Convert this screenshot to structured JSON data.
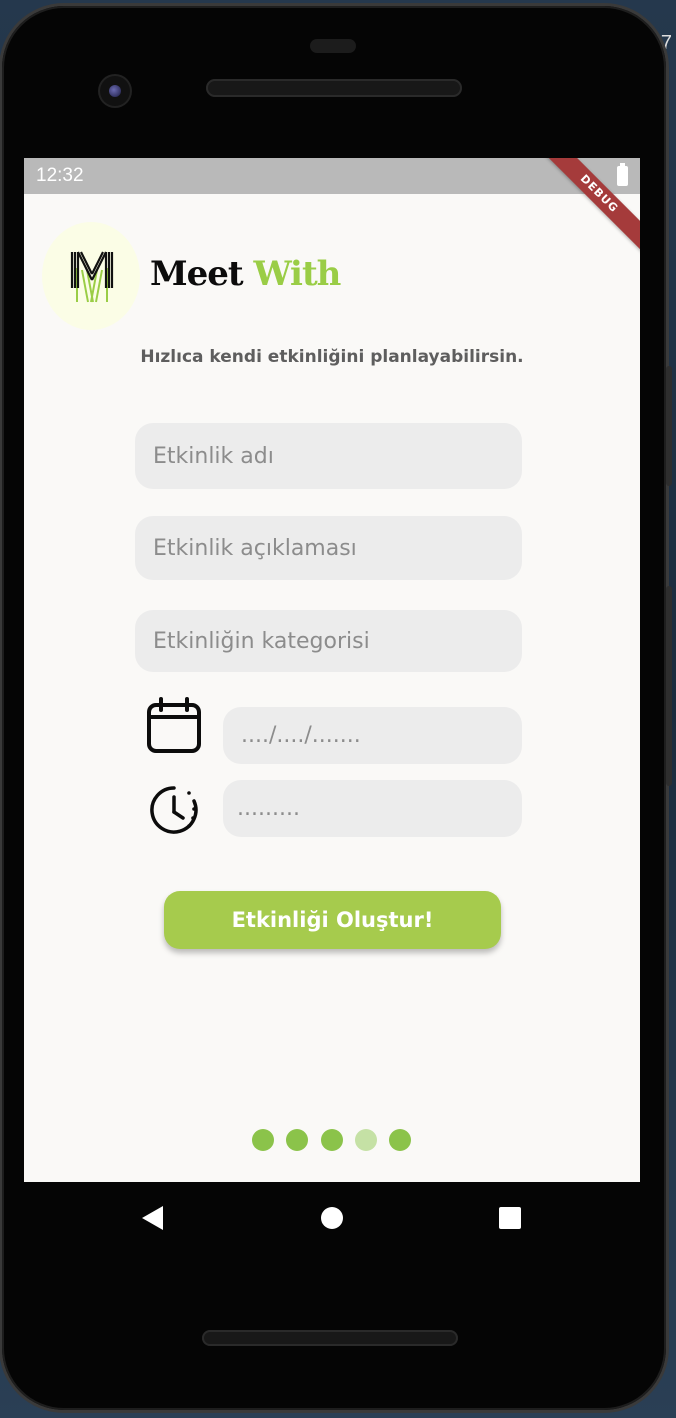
{
  "status": {
    "time": "12:32",
    "debug_label": "DEBUG"
  },
  "device": {
    "edge_text": "7"
  },
  "brand": {
    "part1": "Meet",
    "part2": "With",
    "logo_letter": "M"
  },
  "tagline": "Hızlıca  kendi etkinliğini planlayabilirsin.",
  "form": {
    "name_placeholder": "Etkinlik adı",
    "description_placeholder": "Etkinlik açıklaması",
    "category_placeholder": "Etkinliğin kategorisi",
    "date_placeholder": "..../..../.......",
    "time_placeholder": ".........",
    "submit_label": "Etkinliği Oluştur!"
  },
  "pager": {
    "total": 5,
    "current_index": 3
  },
  "colors": {
    "accent": "#a6cb4d",
    "brand_green": "#9acd46",
    "dot_active": "#8bc34a",
    "dot_inactive": "#c5e1a5"
  }
}
